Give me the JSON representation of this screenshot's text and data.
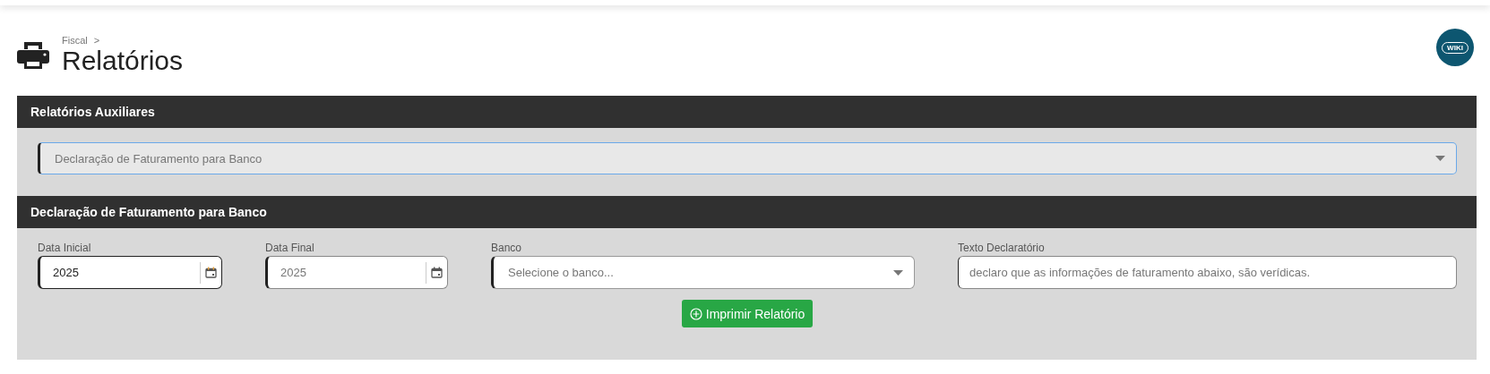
{
  "header": {
    "breadcrumb": "Fiscal",
    "breadcrumb_separator": ">",
    "title": "Relatórios",
    "wiki_label": "WIKI"
  },
  "sections": [
    {
      "title": "Relatórios Auxiliares",
      "select": {
        "value": "Declaração de Faturamento para Banco",
        "focused": true
      }
    },
    {
      "title": "Declaração de Faturamento para Banco",
      "fields": [
        {
          "kind": "date",
          "label": "Data Inicial",
          "value": "2025",
          "focused": true
        },
        {
          "kind": "date",
          "label": "Data Final",
          "placeholder": "2025",
          "focused": false
        },
        {
          "kind": "select",
          "label": "Banco",
          "placeholder": "Selecione o banco...",
          "focused": false
        },
        {
          "kind": "text",
          "label": "Texto Declaratório",
          "placeholder": "declaro que as informações de faturamento abaixo, são verídicas.",
          "focused": false
        }
      ],
      "button": "Imprimir Relatório"
    }
  ]
}
